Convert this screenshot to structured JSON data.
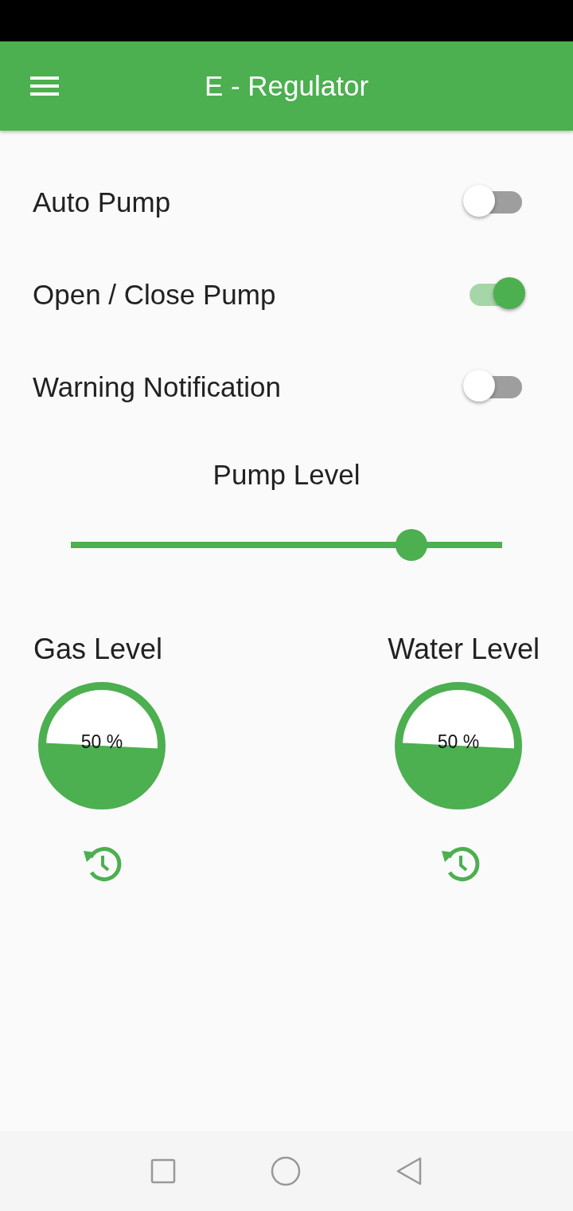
{
  "app_bar": {
    "title": "E - Regulator"
  },
  "switches": [
    {
      "label": "Auto Pump",
      "on": false
    },
    {
      "label": "Open / Close Pump",
      "on": true
    },
    {
      "label": "Warning Notification",
      "on": false
    }
  ],
  "pump_level": {
    "title": "Pump Level",
    "level": 0.79
  },
  "gauges": [
    {
      "label": "Gas Level",
      "reading": "50 %"
    },
    {
      "label": "Water Level",
      "reading": "50 %"
    }
  ]
}
